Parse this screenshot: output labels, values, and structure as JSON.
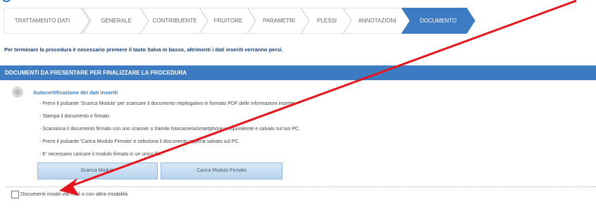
{
  "steps": [
    {
      "label": "TRATTAMENTO DATI",
      "active": false
    },
    {
      "label": "GENERALE",
      "active": false
    },
    {
      "label": "CONTRIBUENTE",
      "active": false
    },
    {
      "label": "FRUITORE",
      "active": false
    },
    {
      "label": "PARAMETRI",
      "active": false
    },
    {
      "label": "PLESSI",
      "active": false
    },
    {
      "label": "ANNOTAZIONI",
      "active": false
    },
    {
      "label": "DOCUMENTO",
      "active": true
    }
  ],
  "warning": "Per terminare la procedura è necessario premere il tasto Salva in basso, altrimenti i dati inseriti verranno persi.",
  "section_title": "DOCUMENTI DA PRESENTARE PER FINALIZZARE LA PROCEDURA",
  "info": {
    "title": "Autocertificazione dei dati inseriti",
    "items": [
      "- Premi il pulsante 'Scarica Modulo' per scaricare il documento riepilogativo in formato PDF delle informazioni inserite.",
      "- Stampa il documento e firmalo.",
      "- Scansiona il documento firmato con uno scanner o tramite fotocamera/smartphone o equivalente e salvalo sul tuo PC.",
      "- Premi il pulsante 'Carica Modulo Firmato' e seleziona il documento appena salvato sul PC.",
      "- E' necessario caricare il modulo firmato in un unico file."
    ]
  },
  "buttons": {
    "download": "Scarica Modulo",
    "upload": "Carica Modulo Firmato"
  },
  "checkbox": {
    "label": "Documenti inviati via mail o con altra modalità",
    "checked": false
  },
  "colors": {
    "accent": "#3d7cc3",
    "active_step": "#3d7cc3",
    "annotation_arrow": "#e8141c"
  }
}
